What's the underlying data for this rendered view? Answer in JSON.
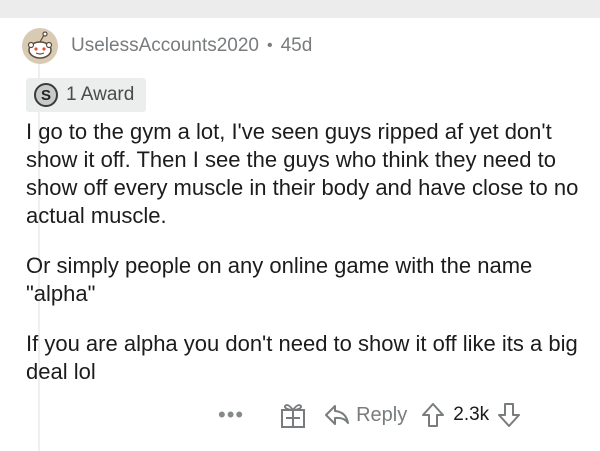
{
  "comment": {
    "author": "UselessAccounts2020",
    "separator": "•",
    "age": "45d",
    "award_label": "1 Award",
    "award_icon": "silver-award-icon",
    "paragraphs": [
      "I go to the gym a lot, I've seen guys ripped af yet don't show it off. Then I see the guys who think they need to show off every muscle in their body and have close to no actual muscle.",
      "Or simply people on any online game with the name \"alpha\"",
      "If you are alpha you don't need to show it off like its a big deal lol"
    ]
  },
  "actions": {
    "more_label": "•••",
    "reply_label": "Reply",
    "score": "2.3k"
  }
}
